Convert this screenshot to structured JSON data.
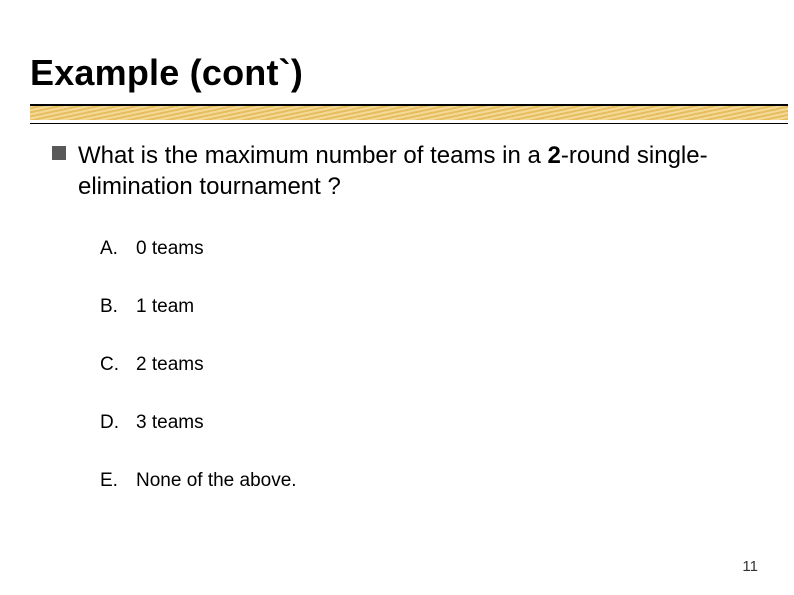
{
  "slide": {
    "title": "Example (cont`)",
    "question_prefix": "What is the maximum number of teams in a ",
    "question_emph": "2",
    "question_suffix": "-round single-elimination tournament ?",
    "options": [
      {
        "letter": "A.",
        "text": "0 teams"
      },
      {
        "letter": "B.",
        "text": "1 team"
      },
      {
        "letter": "C.",
        "text": "2 teams"
      },
      {
        "letter": "D.",
        "text": "3 teams"
      },
      {
        "letter": "E.",
        "text": "None of the above."
      }
    ],
    "page_number": "11"
  }
}
